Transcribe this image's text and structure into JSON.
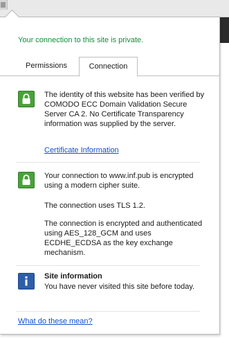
{
  "colors": {
    "status_green": "#118f3b",
    "link_blue": "#1150cc",
    "lock_green": "#4aa13a",
    "info_blue": "#2d5ea8"
  },
  "status": "Your connection to this site is private.",
  "tabs": [
    {
      "label": "Permissions",
      "selected": false
    },
    {
      "label": "Connection",
      "selected": true
    }
  ],
  "identity": {
    "icon": "lock-icon",
    "text": "The identity of this website has been verified by COMODO ECC Domain Validation Secure Server CA 2. No Certificate Transparency information was supplied by the server.",
    "link": "Certificate Information"
  },
  "connection": {
    "icon": "lock-icon",
    "paragraphs": [
      "Your connection to www.inf.pub is encrypted using a modern cipher suite.",
      "The connection uses TLS 1.2.",
      "The connection is encrypted and authenticated using AES_128_GCM and uses ECDHE_ECDSA as the key exchange mechanism."
    ]
  },
  "site_info": {
    "icon": "info-icon",
    "title": "Site information",
    "text": "You have never visited this site before today."
  },
  "help_link": "What do these mean?"
}
